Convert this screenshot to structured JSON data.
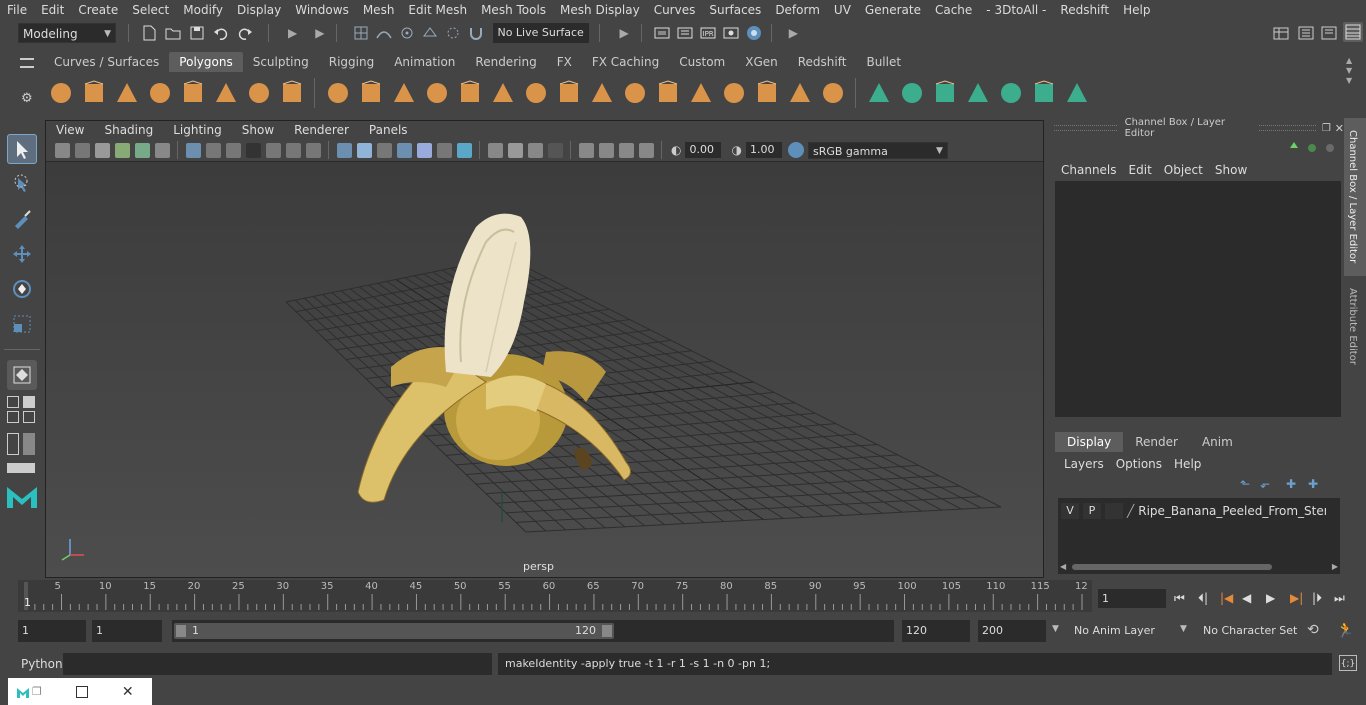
{
  "menubar": [
    "File",
    "Edit",
    "Create",
    "Select",
    "Modify",
    "Display",
    "Windows",
    "Mesh",
    "Edit Mesh",
    "Mesh Tools",
    "Mesh Display",
    "Curves",
    "Surfaces",
    "Deform",
    "UV",
    "Generate",
    "Cache",
    "- 3DtoAll -",
    "Redshift",
    "Help"
  ],
  "statusline": {
    "mode": "Modeling",
    "live_surface": "No Live Surface"
  },
  "shelf_tabs": [
    "Curves / Surfaces",
    "Polygons",
    "Sculpting",
    "Rigging",
    "Animation",
    "Rendering",
    "FX",
    "FX Caching",
    "Custom",
    "XGen",
    "Redshift",
    "Bullet"
  ],
  "shelf_active": "Polygons",
  "viewport": {
    "menu": [
      "View",
      "Shading",
      "Lighting",
      "Show",
      "Renderer",
      "Panels"
    ],
    "exposure": "0.00",
    "gamma": "1.00",
    "colorspace": "sRGB gamma",
    "camera_label": "persp"
  },
  "channel_box": {
    "title": "Channel Box / Layer Editor",
    "menu": [
      "Channels",
      "Edit",
      "Object",
      "Show"
    ]
  },
  "layer_editor": {
    "tabs": [
      "Display",
      "Render",
      "Anim"
    ],
    "active_tab": "Display",
    "menu": [
      "Layers",
      "Options",
      "Help"
    ],
    "layers": [
      {
        "v": "V",
        "p": "P",
        "name": "Ripe_Banana_Peeled_From_Stem_Enc"
      }
    ]
  },
  "side_tabs": [
    "Channel Box / Layer Editor",
    "Attribute Editor"
  ],
  "timeline": {
    "ticks": [
      "5",
      "10",
      "15",
      "20",
      "25",
      "30",
      "35",
      "40",
      "45",
      "50",
      "55",
      "60",
      "65",
      "70",
      "75",
      "80",
      "85",
      "90",
      "95",
      "100",
      "105",
      "110",
      "115",
      "12"
    ],
    "first_label": "1",
    "current_frame": "1"
  },
  "range": {
    "start": "1",
    "anim_start": "1",
    "slider_start": "1",
    "slider_end": "120",
    "end": "120",
    "anim_end": "200",
    "anim_layer": "No Anim Layer",
    "character_set": "No Character Set"
  },
  "command": {
    "language": "Python",
    "history": "makeIdentity -apply true -t 1 -r 1 -s 1 -n 0 -pn 1;"
  },
  "colors": {
    "accent": "#5d8fba",
    "shelf_orange": "#d9944a",
    "shelf_green": "#3cae8e",
    "banana": "#d8b862"
  }
}
